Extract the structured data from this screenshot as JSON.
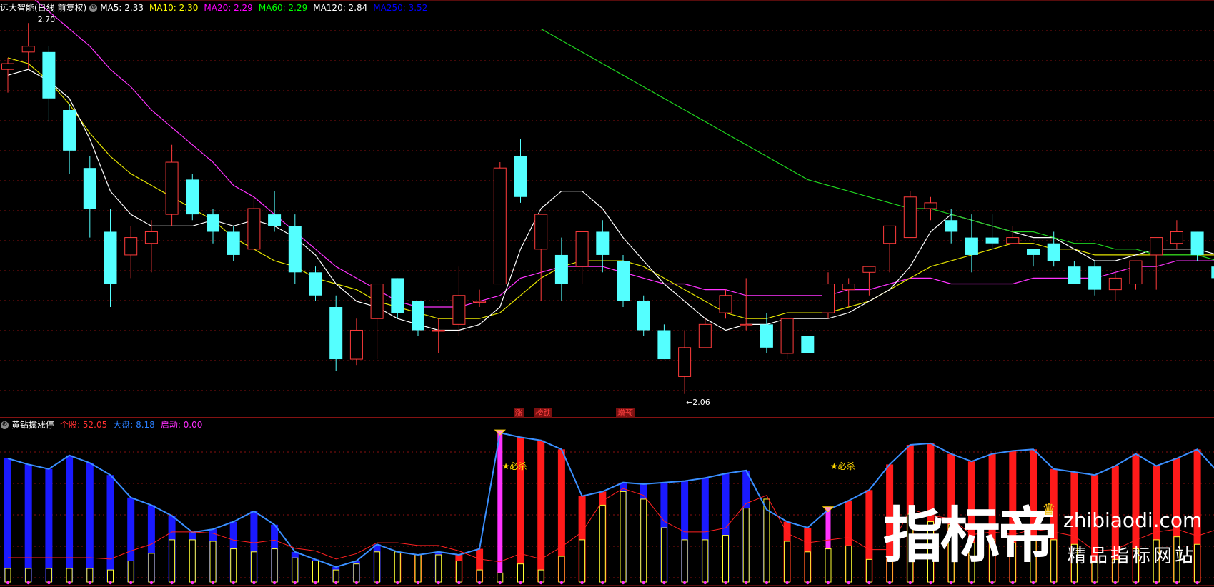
{
  "main_panel": {
    "header": {
      "title": "远大智能(日线 前复权)",
      "indicators": [
        {
          "label": "MA5: 2.33",
          "color": "#ffffff"
        },
        {
          "label": "MA10: 2.30",
          "color": "#ffff00"
        },
        {
          "label": "MA20: 2.29",
          "color": "#ff00ff"
        },
        {
          "label": "MA60: 2.29",
          "color": "#00ff00"
        },
        {
          "label": "MA120: 2.84",
          "color": "#ffffff"
        },
        {
          "label": "MA250: 3.52",
          "color": "#0000ff"
        }
      ]
    },
    "annotations": {
      "high": "2.70",
      "low": "←2.06"
    },
    "signals": [
      {
        "label": "涨",
        "bg": "#7a1010",
        "color": "#ff4040"
      },
      {
        "label": "榜跌",
        "bg": "#7a1010",
        "color": "#ff4040"
      },
      {
        "label": "增预",
        "bg": "#7a1010",
        "color": "#ff4040"
      }
    ],
    "candles": [
      [
        2.62,
        2.64,
        2.58,
        2.63
      ],
      [
        2.65,
        2.7,
        2.62,
        2.66
      ],
      [
        2.65,
        2.66,
        2.53,
        2.57
      ],
      [
        2.55,
        2.56,
        2.44,
        2.48
      ],
      [
        2.45,
        2.47,
        2.33,
        2.38
      ],
      [
        2.34,
        2.38,
        2.21,
        2.25
      ],
      [
        2.3,
        2.35,
        2.26,
        2.33
      ],
      [
        2.32,
        2.36,
        2.27,
        2.34
      ],
      [
        2.37,
        2.49,
        2.35,
        2.46
      ],
      [
        2.43,
        2.44,
        2.36,
        2.37
      ],
      [
        2.37,
        2.38,
        2.32,
        2.34
      ],
      [
        2.34,
        2.35,
        2.29,
        2.3
      ],
      [
        2.31,
        2.4,
        2.31,
        2.38
      ],
      [
        2.37,
        2.41,
        2.34,
        2.35
      ],
      [
        2.35,
        2.37,
        2.25,
        2.27
      ],
      [
        2.27,
        2.28,
        2.22,
        2.23
      ],
      [
        2.21,
        2.23,
        2.1,
        2.12
      ],
      [
        2.12,
        2.19,
        2.11,
        2.17
      ],
      [
        2.19,
        2.21,
        2.12,
        2.25
      ],
      [
        2.26,
        2.26,
        2.19,
        2.2
      ],
      [
        2.22,
        2.22,
        2.16,
        2.17
      ],
      [
        2.17,
        2.19,
        2.13,
        2.17
      ],
      [
        2.18,
        2.28,
        2.16,
        2.23
      ],
      [
        2.22,
        2.24,
        2.21,
        2.22
      ],
      [
        2.25,
        2.46,
        2.25,
        2.45
      ],
      [
        2.47,
        2.5,
        2.39,
        2.4
      ],
      [
        2.31,
        2.37,
        2.22,
        2.37
      ],
      [
        2.3,
        2.33,
        2.22,
        2.25
      ],
      [
        2.28,
        2.3,
        2.25,
        2.34
      ],
      [
        2.34,
        2.36,
        2.27,
        2.3
      ],
      [
        2.29,
        2.3,
        2.21,
        2.22
      ],
      [
        2.22,
        2.23,
        2.16,
        2.17
      ],
      [
        2.17,
        2.18,
        2.12,
        2.12
      ],
      [
        2.09,
        2.17,
        2.06,
        2.14
      ],
      [
        2.14,
        2.19,
        2.14,
        2.18
      ],
      [
        2.2,
        2.24,
        2.19,
        2.23
      ],
      [
        2.18,
        2.26,
        2.17,
        2.18
      ],
      [
        2.18,
        2.2,
        2.13,
        2.14
      ],
      [
        2.13,
        2.19,
        2.12,
        2.19
      ],
      [
        2.16,
        2.16,
        2.13,
        2.13
      ],
      [
        2.2,
        2.27,
        2.19,
        2.25
      ],
      [
        2.24,
        2.26,
        2.21,
        2.25
      ],
      [
        2.27,
        2.28,
        2.23,
        2.28
      ],
      [
        2.32,
        2.33,
        2.27,
        2.35
      ],
      [
        2.33,
        2.41,
        2.34,
        2.4
      ],
      [
        2.38,
        2.4,
        2.36,
        2.39
      ],
      [
        2.36,
        2.38,
        2.32,
        2.34
      ],
      [
        2.33,
        2.37,
        2.27,
        2.3
      ],
      [
        2.33,
        2.37,
        2.31,
        2.32
      ],
      [
        2.32,
        2.35,
        2.32,
        2.33
      ],
      [
        2.31,
        2.31,
        2.28,
        2.3
      ],
      [
        2.32,
        2.34,
        2.28,
        2.29
      ],
      [
        2.28,
        2.29,
        2.26,
        2.25
      ],
      [
        2.28,
        2.29,
        2.23,
        2.24
      ],
      [
        2.24,
        2.27,
        2.22,
        2.26
      ],
      [
        2.25,
        2.26,
        2.24,
        2.29
      ],
      [
        2.3,
        2.32,
        2.24,
        2.33
      ],
      [
        2.32,
        2.36,
        2.31,
        2.34
      ],
      [
        2.34,
        2.34,
        2.29,
        2.3
      ],
      [
        2.28,
        2.3,
        2.25,
        2.26
      ],
      [
        2.2,
        2.51,
        2.18,
        2.49
      ]
    ],
    "ma5": [
      2.61,
      2.62,
      2.6,
      2.57,
      2.5,
      2.41,
      2.37,
      2.35,
      2.35,
      2.35,
      2.36,
      2.35,
      2.36,
      2.35,
      2.33,
      2.3,
      2.25,
      2.22,
      2.21,
      2.19,
      2.18,
      2.17,
      2.17,
      2.18,
      2.21,
      2.31,
      2.38,
      2.41,
      2.41,
      2.38,
      2.33,
      2.29,
      2.25,
      2.22,
      2.19,
      2.17,
      2.18,
      2.18,
      2.19,
      2.19,
      2.19,
      2.2,
      2.22,
      2.24,
      2.28,
      2.34,
      2.37,
      2.36,
      2.35,
      2.34,
      2.33,
      2.33,
      2.31,
      2.29,
      2.29,
      2.3,
      2.31,
      2.31,
      2.31,
      2.3,
      2.33
    ],
    "ma10": [
      2.64,
      2.63,
      2.6,
      2.56,
      2.51,
      2.47,
      2.44,
      2.42,
      2.4,
      2.38,
      2.36,
      2.33,
      2.31,
      2.29,
      2.28,
      2.26,
      2.25,
      2.24,
      2.22,
      2.21,
      2.2,
      2.19,
      2.19,
      2.19,
      2.2,
      2.23,
      2.26,
      2.28,
      2.29,
      2.29,
      2.29,
      2.28,
      2.26,
      2.24,
      2.22,
      2.2,
      2.19,
      2.19,
      2.2,
      2.2,
      2.2,
      2.21,
      2.22,
      2.24,
      2.26,
      2.28,
      2.29,
      2.3,
      2.31,
      2.32,
      2.32,
      2.31,
      2.31,
      2.3,
      2.3,
      2.3,
      2.3,
      2.3,
      2.3,
      2.3,
      2.31
    ],
    "ma20": [
      2.77,
      2.75,
      2.72,
      2.69,
      2.66,
      2.62,
      2.59,
      2.55,
      2.52,
      2.49,
      2.46,
      2.42,
      2.4,
      2.37,
      2.34,
      2.31,
      2.28,
      2.26,
      2.24,
      2.22,
      2.21,
      2.21,
      2.21,
      2.22,
      2.23,
      2.26,
      2.27,
      2.28,
      2.28,
      2.28,
      2.27,
      2.26,
      2.25,
      2.25,
      2.24,
      2.24,
      2.23,
      2.23,
      2.23,
      2.23,
      2.23,
      2.24,
      2.24,
      2.25,
      2.26,
      2.26,
      2.25,
      2.25,
      2.25,
      2.25,
      2.26,
      2.26,
      2.26,
      2.26,
      2.27,
      2.28,
      2.28,
      2.29,
      2.29,
      2.29,
      2.3
    ],
    "ma60": [
      null,
      null,
      null,
      null,
      null,
      null,
      null,
      null,
      null,
      null,
      null,
      null,
      null,
      null,
      null,
      null,
      null,
      null,
      null,
      null,
      null,
      null,
      null,
      null,
      null,
      null,
      2.69,
      2.67,
      2.65,
      2.63,
      2.61,
      2.59,
      2.57,
      2.55,
      2.53,
      2.51,
      2.49,
      2.47,
      2.45,
      2.43,
      2.42,
      2.41,
      2.4,
      2.39,
      2.38,
      2.38,
      2.37,
      2.36,
      2.35,
      2.34,
      2.34,
      2.33,
      2.32,
      2.32,
      2.31,
      2.31,
      2.3,
      2.3,
      2.3,
      2.29,
      2.29
    ]
  },
  "sub_panel": {
    "header": {
      "title": "黄钻擒涨停",
      "indicators": [
        {
          "label": "个股: 52.05",
          "color": "#ff3030"
        },
        {
          "label": "大盘: 8.18",
          "color": "#2a7fff"
        },
        {
          "label": "启动: 0.00",
          "color": "#ff30ff"
        }
      ]
    },
    "markers": [
      {
        "label": "★必杀",
        "color": "#ffd700"
      },
      {
        "label": "★必杀",
        "color": "#ffd700"
      }
    ],
    "bars": [
      {
        "v": 82,
        "c": "blue",
        "y": 9
      },
      {
        "v": 78,
        "c": "blue",
        "y": 9
      },
      {
        "v": 75,
        "c": "blue",
        "y": 9
      },
      {
        "v": 84,
        "c": "blue",
        "y": 9
      },
      {
        "v": 79,
        "c": "blue",
        "y": 9
      },
      {
        "v": 71,
        "c": "blue",
        "y": 8
      },
      {
        "v": 56,
        "c": "blue",
        "y": 14
      },
      {
        "v": 51,
        "c": "blue",
        "y": 19
      },
      {
        "v": 44,
        "c": "blue",
        "y": 28
      },
      {
        "v": 33,
        "c": "blue",
        "y": 28
      },
      {
        "v": 35,
        "c": "blue",
        "y": 27
      },
      {
        "v": 40,
        "c": "blue",
        "y": 22
      },
      {
        "v": 47,
        "c": "blue",
        "y": 20
      },
      {
        "v": 38,
        "c": "blue",
        "y": 22
      },
      {
        "v": 20,
        "c": "blue",
        "y": 16
      },
      {
        "v": 15,
        "c": "blue",
        "y": 14
      },
      {
        "v": 10,
        "c": "blue",
        "y": 8
      },
      {
        "v": 14,
        "c": "blue",
        "y": 12
      },
      {
        "v": 25,
        "c": "blue",
        "y": 20
      },
      {
        "v": 20,
        "c": "red",
        "y": 20
      },
      {
        "v": 18,
        "c": "red",
        "y": 18
      },
      {
        "v": 20,
        "c": "blue",
        "y": 18
      },
      {
        "v": 18,
        "c": "red",
        "y": 14
      },
      {
        "v": 22,
        "c": "red",
        "y": 8
      },
      {
        "v": 99,
        "c": "magenta",
        "y": 6
      },
      {
        "v": 96,
        "c": "red",
        "y": 12
      },
      {
        "v": 94,
        "c": "red",
        "y": 8
      },
      {
        "v": 88,
        "c": "red",
        "y": 17
      },
      {
        "v": 57,
        "c": "red",
        "y": 28
      },
      {
        "v": 60,
        "c": "red",
        "y": 51
      },
      {
        "v": 66,
        "c": "blue",
        "y": 60
      },
      {
        "v": 65,
        "c": "blue",
        "y": 55
      },
      {
        "v": 66,
        "c": "blue",
        "y": 36
      },
      {
        "v": 67,
        "c": "blue",
        "y": 28
      },
      {
        "v": 69,
        "c": "blue",
        "y": 28
      },
      {
        "v": 72,
        "c": "blue",
        "y": 31
      },
      {
        "v": 74,
        "c": "blue",
        "y": 49
      },
      {
        "v": 48,
        "c": "blue",
        "y": 55
      },
      {
        "v": 40,
        "c": "red",
        "y": 27
      },
      {
        "v": 36,
        "c": "red",
        "y": 20
      },
      {
        "v": 48,
        "c": "magenta",
        "y": 22
      },
      {
        "v": 54,
        "c": "red",
        "y": 24
      },
      {
        "v": 61,
        "c": "red",
        "y": 15
      },
      {
        "v": 78,
        "c": "red",
        "y": 15
      },
      {
        "v": 91,
        "c": "red",
        "y": 45
      },
      {
        "v": 92,
        "c": "red",
        "y": 40
      },
      {
        "v": 85,
        "c": "red",
        "y": 38
      },
      {
        "v": 80,
        "c": "red",
        "y": 26
      },
      {
        "v": 85,
        "c": "red",
        "y": 28
      },
      {
        "v": 87,
        "c": "red",
        "y": 26
      },
      {
        "v": 88,
        "c": "red",
        "y": 30
      },
      {
        "v": 75,
        "c": "red",
        "y": 28
      },
      {
        "v": 73,
        "c": "red",
        "y": 25
      },
      {
        "v": 71,
        "c": "red",
        "y": 14
      },
      {
        "v": 77,
        "c": "red",
        "y": 15
      },
      {
        "v": 85,
        "c": "red",
        "y": 22
      },
      {
        "v": 77,
        "c": "red",
        "y": 28
      },
      {
        "v": 82,
        "c": "red",
        "y": 30
      },
      {
        "v": 88,
        "c": "red",
        "y": 25
      },
      {
        "v": 73,
        "c": "red",
        "y": 30
      },
      {
        "v": 99,
        "c": "red",
        "y": 35
      }
    ]
  },
  "watermark": {
    "brand": "指标帝",
    "url": "zhibiaodi.com",
    "tagline": "精品指标网站"
  }
}
